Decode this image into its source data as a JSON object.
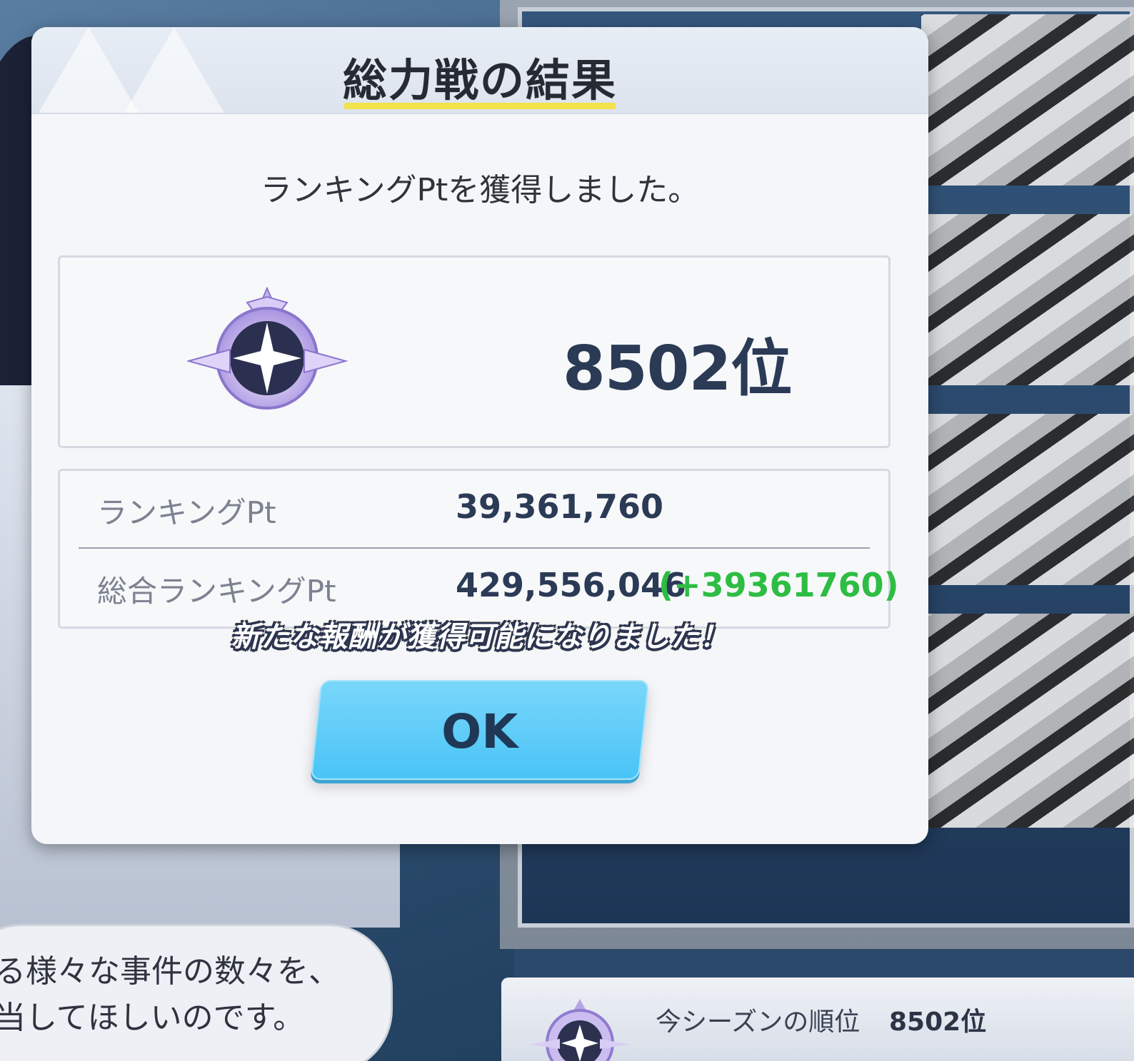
{
  "modal": {
    "title": "総力戦の結果",
    "message": "ランキングPtを獲得しました。",
    "rank": "8502位",
    "ranking_pt_label": "ランキングPt",
    "ranking_pt_value": "39,361,760",
    "total_ranking_pt_label": "総合ランキングPt",
    "total_ranking_pt_value": "429,556,046",
    "total_ranking_pt_gain": "(+39361760)",
    "reward_notice": "新たな報酬が獲得可能になりました！",
    "ok_label": "OK"
  },
  "dialogue": {
    "line1": "る様々な事件の数々を、",
    "line2": "当してほしいのです。"
  },
  "season": {
    "label": "今シーズンの順位",
    "rank": "8502位"
  },
  "colors": {
    "accent_underline": "#f3e24a",
    "rank_text": "#2b3a55",
    "gain_green": "#2ebd44",
    "ok_button": "#5ccaf8"
  },
  "icons": {
    "rank_emblem": "rank-emblem-icon",
    "season_emblem": "season-emblem-icon"
  }
}
